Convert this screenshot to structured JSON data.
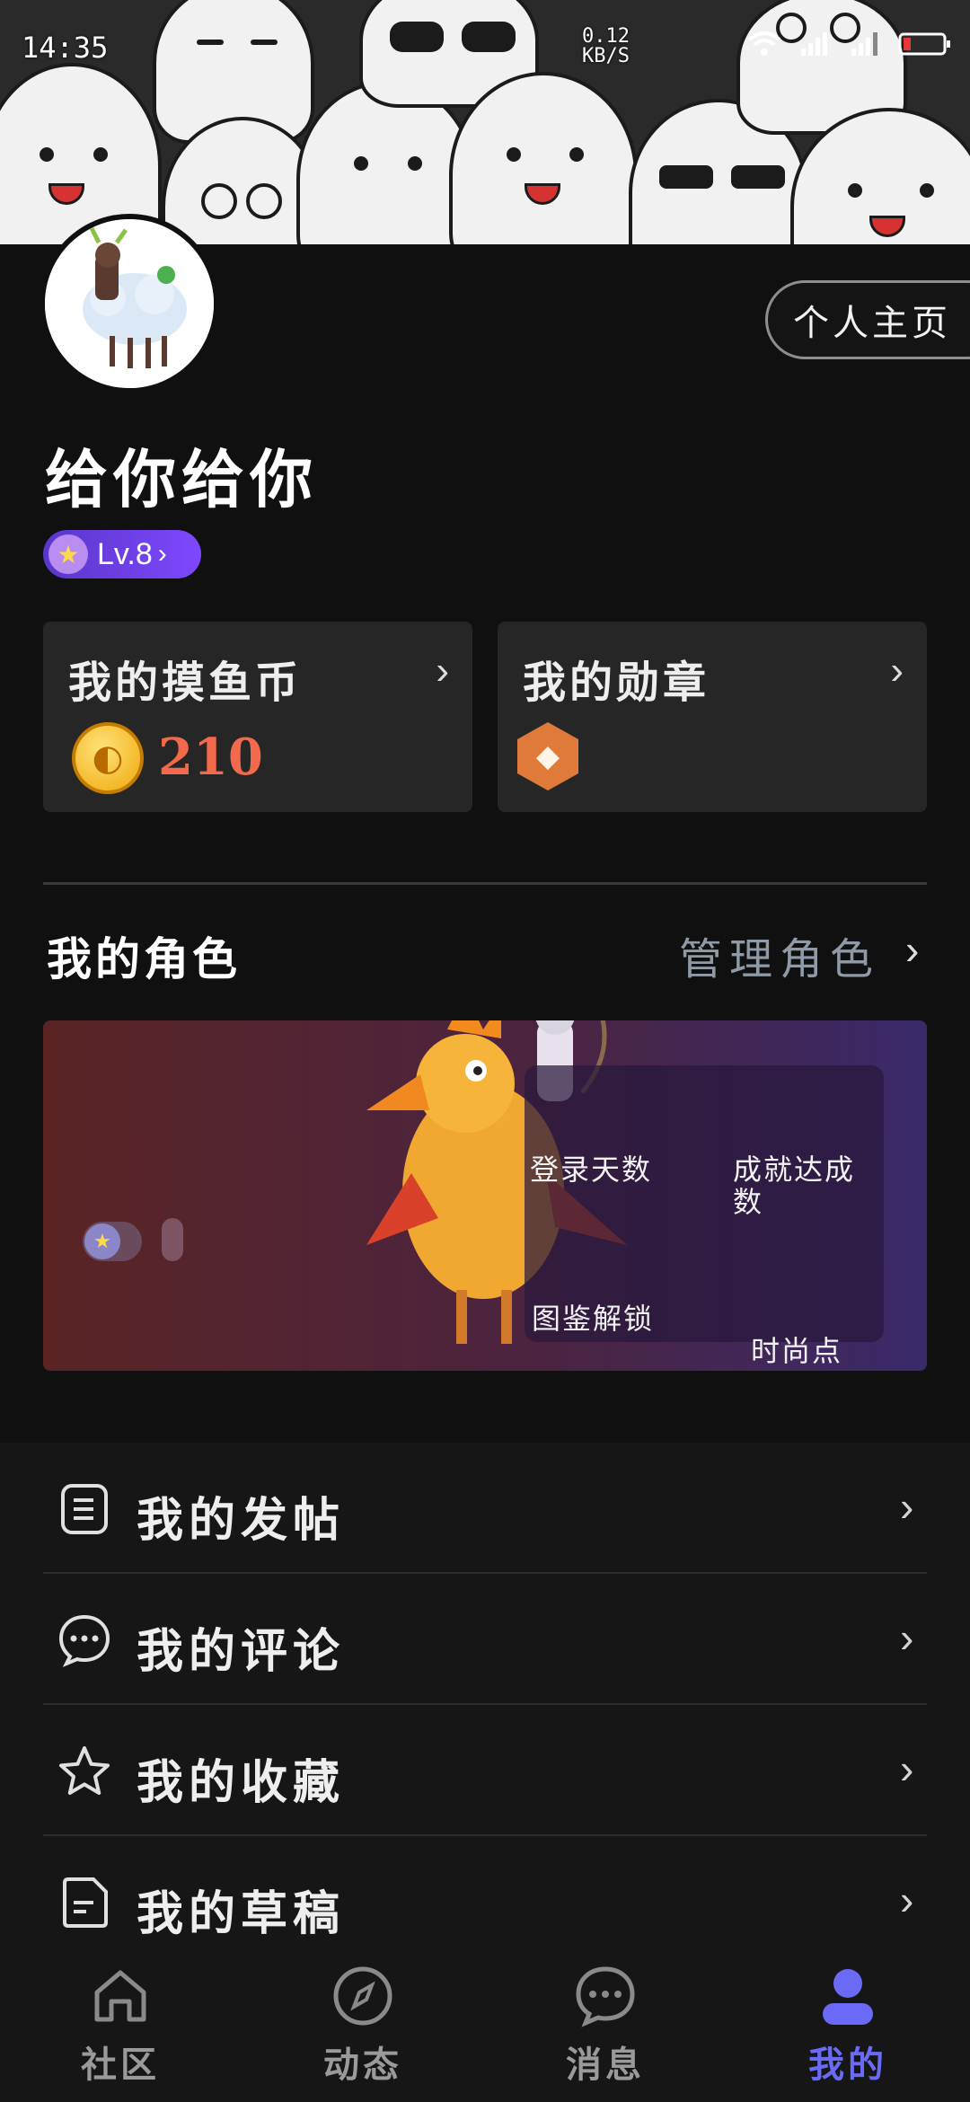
{
  "status_bar": {
    "time": "14:35",
    "net_speed_value": "0.12",
    "net_speed_unit": "KB/S"
  },
  "profile": {
    "nickname": "给你给你",
    "level": "Lv.8",
    "home_button": "个人主页"
  },
  "cards": {
    "coins": {
      "title": "我的摸鱼币",
      "value": "210"
    },
    "medals": {
      "title": "我的勋章"
    }
  },
  "roles": {
    "title": "我的角色",
    "manage": "管理角色",
    "stats": {
      "login_days": "登录天数",
      "achievements": "成就达成数",
      "codex": "图鉴解锁",
      "fashion": "时尚点"
    }
  },
  "menu": {
    "items": [
      {
        "label": "我的发帖",
        "icon": "document-list-icon"
      },
      {
        "label": "我的评论",
        "icon": "comment-icon"
      },
      {
        "label": "我的收藏",
        "icon": "star-icon"
      },
      {
        "label": "我的草稿",
        "icon": "draft-icon"
      }
    ]
  },
  "bottom_nav": {
    "items": [
      {
        "label": "社区",
        "icon": "home-icon"
      },
      {
        "label": "动态",
        "icon": "compass-icon"
      },
      {
        "label": "消息",
        "icon": "chat-icon"
      },
      {
        "label": "我的",
        "icon": "user-icon"
      }
    ],
    "active_index": 3
  },
  "colors": {
    "accent": "#6b6af6",
    "coin_value": "#f26a4b",
    "background": "#101010"
  }
}
